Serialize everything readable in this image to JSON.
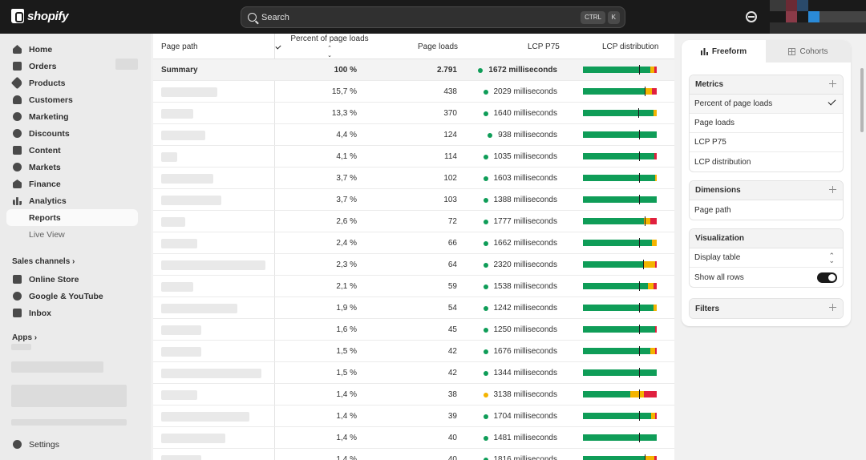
{
  "topbar": {
    "logo_text": "shopify",
    "search_placeholder": "Search",
    "shortcut_ctrl": "CTRL",
    "shortcut_k": "K"
  },
  "sidebar": {
    "items": [
      {
        "label": "Home",
        "icon": "home-icon"
      },
      {
        "label": "Orders",
        "icon": "orders-icon"
      },
      {
        "label": "Products",
        "icon": "tag-icon"
      },
      {
        "label": "Customers",
        "icon": "person-icon"
      },
      {
        "label": "Marketing",
        "icon": "target-icon"
      },
      {
        "label": "Discounts",
        "icon": "discount-icon"
      },
      {
        "label": "Content",
        "icon": "content-icon"
      },
      {
        "label": "Markets",
        "icon": "globe-icon"
      },
      {
        "label": "Finance",
        "icon": "bank-icon"
      },
      {
        "label": "Analytics",
        "icon": "bar-chart-icon"
      }
    ],
    "analytics_sub": [
      {
        "label": "Reports"
      },
      {
        "label": "Live View"
      }
    ],
    "sales_channels_label": "Sales channels",
    "channels": [
      {
        "label": "Online Store",
        "icon": "store-icon"
      },
      {
        "label": "Google & YouTube",
        "icon": "google-icon"
      },
      {
        "label": "Inbox",
        "icon": "inbox-icon"
      }
    ],
    "apps_label": "Apps",
    "settings_label": "Settings"
  },
  "table": {
    "columns": [
      "Page path",
      "Percent of page loads",
      "Page loads",
      "LCP P75",
      "LCP distribution"
    ],
    "summary": {
      "path": "Summary",
      "percent": "100 %",
      "loads": "2.791",
      "lcp": "1672 milliseconds",
      "status": "good"
    },
    "rows": [
      {
        "percent": "15,7 %",
        "loads": "438",
        "lcp": "2029 milliseconds",
        "status": "good"
      },
      {
        "percent": "13,3 %",
        "loads": "370",
        "lcp": "1640 milliseconds",
        "status": "good"
      },
      {
        "percent": "4,4 %",
        "loads": "124",
        "lcp": "938 milliseconds",
        "status": "good"
      },
      {
        "percent": "4,1 %",
        "loads": "114",
        "lcp": "1035 milliseconds",
        "status": "good"
      },
      {
        "percent": "3,7 %",
        "loads": "102",
        "lcp": "1603 milliseconds",
        "status": "good"
      },
      {
        "percent": "3,7 %",
        "loads": "103",
        "lcp": "1388 milliseconds",
        "status": "good"
      },
      {
        "percent": "2,6 %",
        "loads": "72",
        "lcp": "1777 milliseconds",
        "status": "good"
      },
      {
        "percent": "2,4 %",
        "loads": "66",
        "lcp": "1662 milliseconds",
        "status": "good"
      },
      {
        "percent": "2,3 %",
        "loads": "64",
        "lcp": "2320 milliseconds",
        "status": "good"
      },
      {
        "percent": "2,1 %",
        "loads": "59",
        "lcp": "1538 milliseconds",
        "status": "good"
      },
      {
        "percent": "1,9 %",
        "loads": "54",
        "lcp": "1242 milliseconds",
        "status": "good"
      },
      {
        "percent": "1,6 %",
        "loads": "45",
        "lcp": "1250 milliseconds",
        "status": "good"
      },
      {
        "percent": "1,5 %",
        "loads": "42",
        "lcp": "1676 milliseconds",
        "status": "good"
      },
      {
        "percent": "1,5 %",
        "loads": "42",
        "lcp": "1344 milliseconds",
        "status": "good"
      },
      {
        "percent": "1,4 %",
        "loads": "38",
        "lcp": "3138 milliseconds",
        "status": "needs-improvement"
      },
      {
        "percent": "1,4 %",
        "loads": "39",
        "lcp": "1704 milliseconds",
        "status": "good"
      },
      {
        "percent": "1,4 %",
        "loads": "40",
        "lcp": "1481 milliseconds",
        "status": "good"
      },
      {
        "percent": "1,4 %",
        "loads": "40",
        "lcp": "1816 milliseconds",
        "status": "good"
      }
    ],
    "distributions": [
      [
        0.91,
        0.06,
        0.03
      ],
      [
        0.85,
        0.08,
        0.07
      ],
      [
        0.96,
        0.04,
        0.0
      ],
      [
        1.0,
        0.0,
        0.0
      ],
      [
        0.97,
        0.0,
        0.03
      ],
      [
        0.98,
        0.02,
        0.0
      ],
      [
        1.0,
        0.0,
        0.0
      ],
      [
        0.83,
        0.08,
        0.09
      ],
      [
        0.94,
        0.06,
        0.0
      ],
      [
        0.82,
        0.16,
        0.02
      ],
      [
        0.88,
        0.08,
        0.04
      ],
      [
        0.96,
        0.04,
        0.0
      ],
      [
        0.98,
        0.0,
        0.02
      ],
      [
        0.91,
        0.07,
        0.02
      ],
      [
        1.0,
        0.0,
        0.0
      ],
      [
        0.64,
        0.19,
        0.17
      ],
      [
        0.92,
        0.06,
        0.02
      ],
      [
        1.0,
        0.0,
        0.0
      ],
      [
        0.84,
        0.13,
        0.03
      ]
    ],
    "p75_markers": [
      0.76,
      0.84,
      0.75,
      0.76,
      0.76,
      0.76,
      0.76,
      0.84,
      0.76,
      0.82,
      0.76,
      0.76,
      0.76,
      0.76,
      0.76,
      0.76,
      0.76,
      0.76,
      0.84
    ]
  },
  "colors": {
    "good": "#0f9d58",
    "needs-improvement": "#f4b400",
    "poor": "#e0203f"
  },
  "panel": {
    "tab_freeform": "Freeform",
    "tab_cohorts": "Cohorts",
    "metrics_title": "Metrics",
    "metrics": [
      "Percent of page loads",
      "Page loads",
      "LCP P75",
      "LCP distribution"
    ],
    "dimensions_title": "Dimensions",
    "dimensions": [
      "Page path"
    ],
    "visualization_title": "Visualization",
    "visualization_type": "Display table",
    "show_all_rows": "Show all rows",
    "filters_title": "Filters"
  }
}
